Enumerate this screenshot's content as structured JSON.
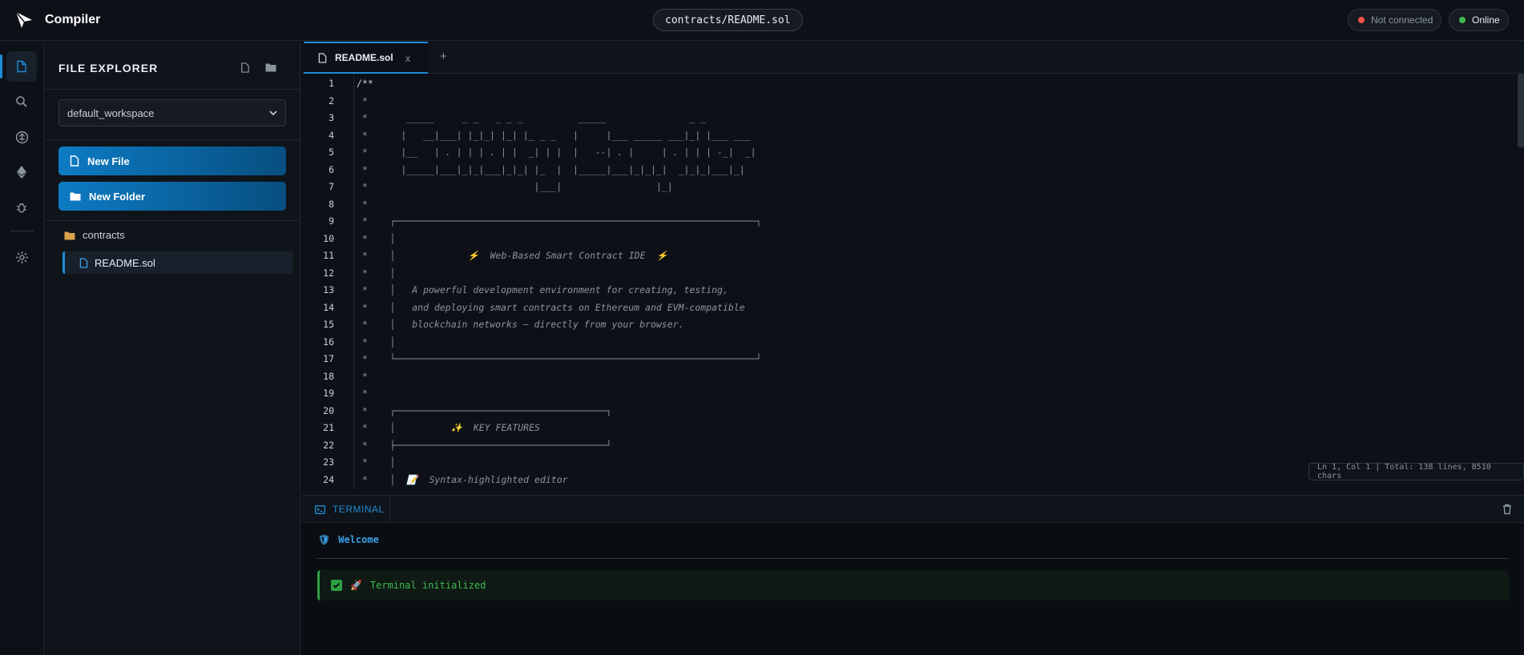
{
  "header": {
    "brand": "Compiler",
    "path": "contracts/README.sol",
    "status_not_connected": "Not connected",
    "status_online": "Online",
    "colors": {
      "offline": "#f85149",
      "online": "#3fb950",
      "accent": "#1f8bd4"
    }
  },
  "activity": {
    "items": [
      "file-explorer",
      "search",
      "compiler",
      "deploy",
      "debugger",
      "settings"
    ]
  },
  "sidebar": {
    "title": "FILE EXPLORER",
    "workspace": "default_workspace",
    "new_file_label": "New File",
    "new_folder_label": "New Folder",
    "folder": "contracts",
    "file": "README.sol"
  },
  "editor": {
    "tab_label": "README.sol",
    "tab_close": "x",
    "tab_add": "+",
    "lines": [
      "/**",
      " *",
      " *       _____     _ _   _ _ _          _____               _ _",
      " *      |   __|___| |_|_| |_| |_ _ _   |     |___ _____ ___|_| |___ ___",
      " *      |__   | . | | | . | |  _| | |  |   --| . |     | . | | | -_|  _|",
      " *      |_____|___|_|_|___|_|_| |_  |  |_____|___|_|_|_|  _|_|_|___|_|",
      " *                              |___|                 |_|",
      " *",
      " *    ┌─────────────────────────────────────────────────────────────────┐",
      " *    │",
      " *    │             ⚡  Web-Based Smart Contract IDE  ⚡",
      " *    │",
      " *    │   A powerful development environment for creating, testing,",
      " *    │   and deploying smart contracts on Ethereum and EVM-compatible",
      " *    │   blockchain networks — directly from your browser.",
      " *    │",
      " *    └─────────────────────────────────────────────────────────────────┘",
      " *",
      " *",
      " *    ┌──────────────────────────────────────┐",
      " *    │          ✨  KEY FEATURES",
      " *    ├──────────────────────────────────────┘",
      " *    │",
      " *    │  📝  Syntax-highlighted editor"
    ],
    "status": "Ln 1, Col 1 | Total: 138 lines, 8510 chars"
  },
  "terminal": {
    "tab_label": "TERMINAL",
    "welcome": "Welcome",
    "welcome_emoji": "🛡",
    "line_emoji": "🚀",
    "line_text": "Terminal initialized"
  }
}
